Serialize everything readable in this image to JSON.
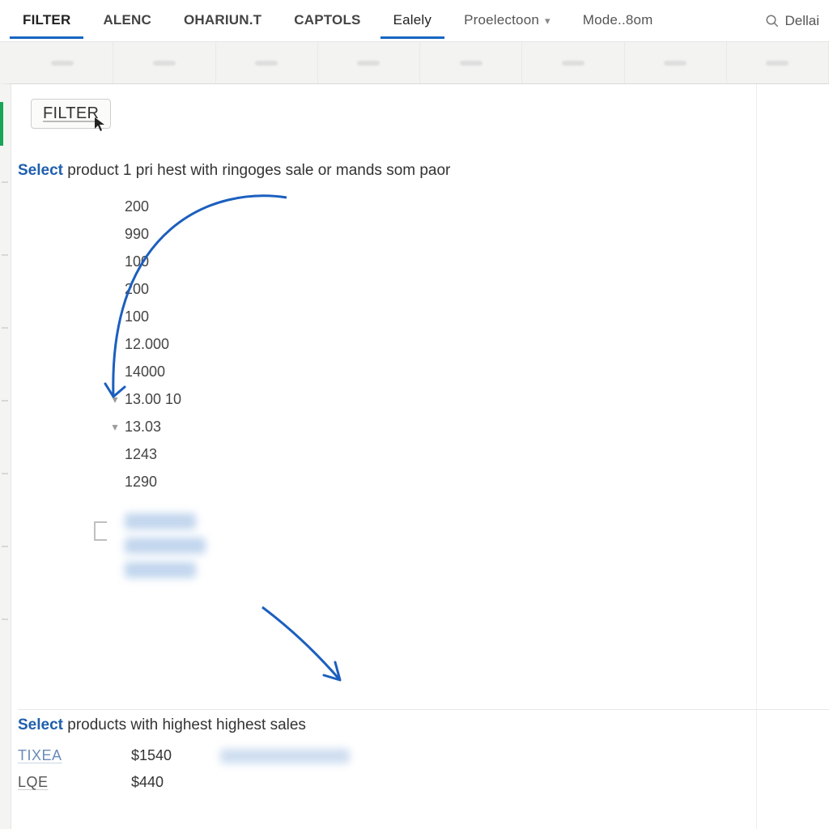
{
  "tabs": {
    "filter": {
      "label": "FILTER",
      "active": true
    },
    "alenc": {
      "label": "ALENC",
      "active": false
    },
    "ohariunt": {
      "label": "OHARIUN.T",
      "active": false
    },
    "captols": {
      "label": "CAPTOLS",
      "active": false
    },
    "ealely": {
      "label": "Ealely",
      "active": true
    },
    "proel": {
      "label": "Proelectoon",
      "active": false
    },
    "mode": {
      "label": "Mode..8om",
      "active": false
    }
  },
  "search": {
    "placeholder": "Dellai"
  },
  "filter_chip": "FILTER",
  "select1": {
    "keyword": "Select",
    "rest": " product 1 pri hest with ringoges sale or mands som paor"
  },
  "numbers": [
    {
      "v": "200"
    },
    {
      "v": "990"
    },
    {
      "v": "100"
    },
    {
      "v": "200"
    },
    {
      "v": "100"
    },
    {
      "v": "12.000"
    },
    {
      "v": "14000"
    },
    {
      "v": "13.00 10",
      "chev": true,
      "strike": false
    },
    {
      "v": "13.03",
      "chev": true
    },
    {
      "v": "1243"
    },
    {
      "v": "1290"
    }
  ],
  "select2": {
    "keyword": "Select",
    "rest": " products with highest highest sales"
  },
  "results": [
    {
      "label": "TIXEA",
      "value": "$1540",
      "highlight": true
    },
    {
      "label": "LQE",
      "value": "$440",
      "highlight": false
    }
  ]
}
